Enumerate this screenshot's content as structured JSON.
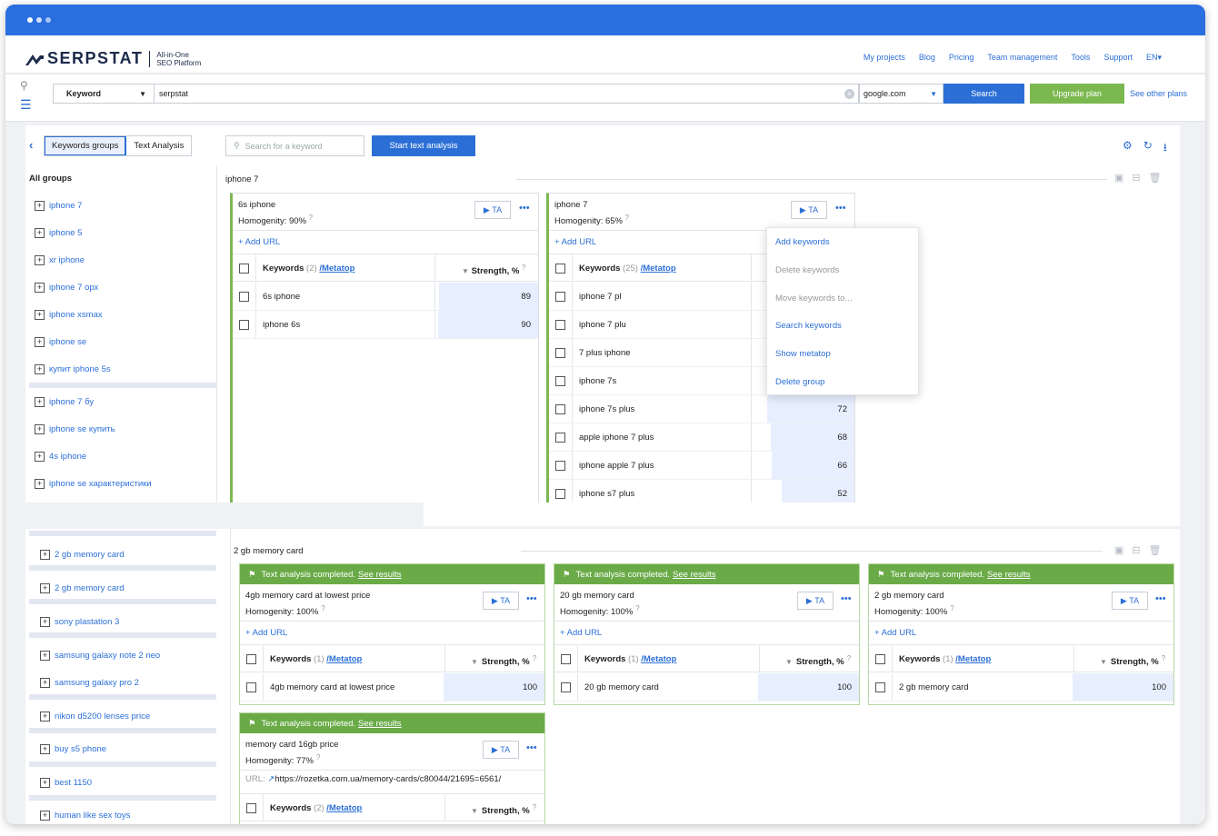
{
  "app": {
    "logo_text": "SERPSTAT",
    "logo_sub1": "All-in-One",
    "logo_sub2": "SEO Platform"
  },
  "nav": [
    "My projects",
    "Blog",
    "Pricing",
    "Team management",
    "Tools",
    "Support",
    "EN▾"
  ],
  "search": {
    "type_value": "Keyword",
    "query": "serpstat",
    "engine": "google.com",
    "search_label": "Search",
    "upgrade_label": "Upgrade plan",
    "other_plans_label": "See other plans"
  },
  "toolbar": {
    "tab_groups": "Keywords groups",
    "tab_text": "Text Analysis",
    "kw_placeholder": "Search for a keyword",
    "start_label": "Start text analysis"
  },
  "sidebar": {
    "heading": "All groups",
    "items_top": [
      "iphone 7",
      "iphone 5",
      "xr iphone",
      "iphone 7 орх",
      "iphone xsmax",
      "iphone se",
      "купит iphone 5s",
      "iphone 7 бу",
      "iphone se купить",
      "4s iphone",
      "iphone se характеристики"
    ],
    "items_bottom": [
      "2 gb memory card",
      "2 gb memory card",
      "sony plastation 3",
      "samsung galaxy note 2 neo",
      "samsung galaxy pro 2",
      "nikon d5200 lenses price",
      "buy s5 phone",
      "best 1150",
      "human like sex toys"
    ]
  },
  "group1": {
    "title": "iphone 7",
    "cards": [
      {
        "name": "6s iphone",
        "homogeneity": "Homogenity: 90%",
        "add_url": "+ Add URL",
        "kw_label": "Keywords",
        "kw_count": "(2)",
        "metatop": "/Metatop",
        "strength_label": "Strength, %",
        "rows": [
          {
            "kw": "6s iphone",
            "val": "89",
            "frac": 0.89
          },
          {
            "kw": "iphone 6s",
            "val": "90",
            "frac": 0.9
          }
        ]
      },
      {
        "name": "iphone 7",
        "homogeneity": "Homogenity: 65%",
        "add_url": "+ Add URL",
        "kw_label": "Keywords",
        "kw_count": "(25)",
        "metatop": "/Metatop",
        "strength_label": "Strength, %",
        "rows": [
          {
            "kw": "iphone 7 pl",
            "val": "",
            "frac": 0
          },
          {
            "kw": "iphone 7 plu",
            "val": "",
            "frac": 0
          },
          {
            "kw": "7 plus iphone",
            "val": "",
            "frac": 0
          },
          {
            "kw": "iphone 7s",
            "val": "",
            "frac": 0
          },
          {
            "kw": "iphone 7s plus",
            "val": "72",
            "frac": 0.72
          },
          {
            "kw": "apple iphone 7 plus",
            "val": "68",
            "frac": 0.68
          },
          {
            "kw": "iphone apple 7 plus",
            "val": "66",
            "frac": 0.66
          },
          {
            "kw": "iphone s7 plus",
            "val": "52",
            "frac": 0.52
          }
        ]
      }
    ]
  },
  "dropdown": [
    "Add keywords",
    "Delete keywords",
    "Move keywords to...",
    "Search keywords",
    "Show metatop",
    "Delete group"
  ],
  "group2": {
    "title": "2 gb memory card",
    "banner_text": "Text analysis completed.",
    "banner_link": "See results",
    "cards": [
      {
        "name": "4gb memory card at lowest price",
        "homogeneity": "Homogenity: 100%",
        "add_url": "+ Add URL",
        "kw_label": "Keywords",
        "kw_count": "(1)",
        "metatop": "/Metatop",
        "strength_label": "Strength, %",
        "rows": [
          {
            "kw": "4gb memory card at lowest price",
            "val": "100",
            "frac": 1
          }
        ]
      },
      {
        "name": "20 gb memory card",
        "homogeneity": "Homogenity: 100%",
        "add_url": "+ Add URL",
        "kw_label": "Keywords",
        "kw_count": "(1)",
        "metatop": "/Metatop",
        "strength_label": "Strength, %",
        "rows": [
          {
            "kw": "20 gb memory card",
            "val": "100",
            "frac": 1
          }
        ]
      },
      {
        "name": "2 gb memory card",
        "homogeneity": "Homogenity: 100%",
        "add_url": "+ Add URL",
        "kw_label": "Keywords",
        "kw_count": "(1)",
        "metatop": "/Metatop",
        "strength_label": "Strength, %",
        "rows": [
          {
            "kw": "2 gb memory card",
            "val": "100",
            "frac": 1
          }
        ]
      },
      {
        "name": "memory card 16gb price",
        "homogeneity": "Homogenity: 77%",
        "url_label": "URL:",
        "url": "https://rozetka.com.ua/memory-cards/c80044/21695=6561/",
        "kw_label": "Keywords",
        "kw_count": "(2)",
        "metatop": "/Metatop",
        "strength_label": "Strength, %",
        "rows": []
      }
    ]
  },
  "colors": {
    "accent": "#2b6fd6",
    "green": "#7cb850",
    "titlebar": "#2a6ee0"
  }
}
